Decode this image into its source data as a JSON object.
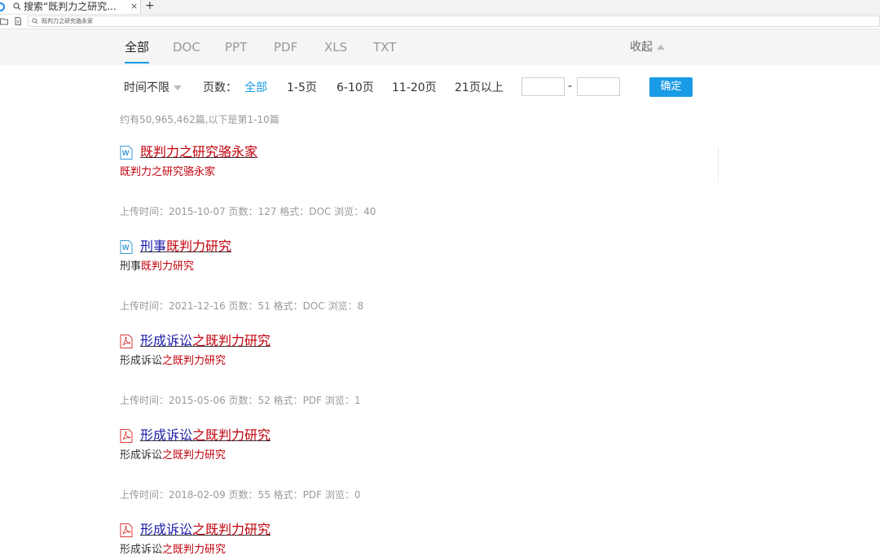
{
  "browser": {
    "tab_title": "搜索“既判力之研究...",
    "tab_close": "×",
    "new_tab": "+",
    "address_text": "既判力之研究骆永家"
  },
  "filters": {
    "type_tabs": [
      {
        "label": "全部",
        "active": true
      },
      {
        "label": "DOC",
        "active": false
      },
      {
        "label": "PPT",
        "active": false
      },
      {
        "label": "PDF",
        "active": false
      },
      {
        "label": "XLS",
        "active": false
      },
      {
        "label": "TXT",
        "active": false
      }
    ],
    "collapse_label": "收起",
    "time_label": "时间不限",
    "pages_label": "页数：",
    "page_options": [
      {
        "label": "全部",
        "active": true
      },
      {
        "label": "1-5页",
        "active": false
      },
      {
        "label": "6-10页",
        "active": false
      },
      {
        "label": "11-20页",
        "active": false
      },
      {
        "label": "21页以上",
        "active": false
      }
    ],
    "range_from": "",
    "range_to": "",
    "range_separator": "-",
    "confirm_label": "确定"
  },
  "result_count": "约有50,965,462篇,以下是第1-10篇",
  "colors": {
    "accent": "#1a9be6",
    "highlight": "#c0000b",
    "link": "#1a1aa6"
  },
  "results": [
    {
      "icon": "word-doc-icon",
      "title": [
        {
          "text": "既判力之研究骆永家",
          "hl": true
        }
      ],
      "snippet": [
        {
          "text": "既判力之研究骆永家",
          "hl": true
        }
      ],
      "meta": "上传时间：2015-10-07    页数：127    格式：DOC    浏览：40"
    },
    {
      "icon": "word-doc-icon",
      "title": [
        {
          "text": "刑事",
          "hl": false
        },
        {
          "text": "既判力研究",
          "hl": true
        }
      ],
      "snippet": [
        {
          "text": "刑事",
          "hl": false
        },
        {
          "text": "既判力研究",
          "hl": true
        }
      ],
      "meta": "上传时间：2021-12-16    页数：51    格式：DOC    浏览：8"
    },
    {
      "icon": "pdf-icon",
      "title": [
        {
          "text": "形成诉讼",
          "hl": false
        },
        {
          "text": "之既判力研究",
          "hl": true
        }
      ],
      "snippet": [
        {
          "text": "形成诉讼",
          "hl": false
        },
        {
          "text": "之既判力研究",
          "hl": true
        }
      ],
      "meta": "上传时间：2015-05-06    页数：52    格式：PDF    浏览：1"
    },
    {
      "icon": "pdf-icon",
      "title": [
        {
          "text": "形成诉讼",
          "hl": false
        },
        {
          "text": "之既判力研究",
          "hl": true
        }
      ],
      "snippet": [
        {
          "text": "形成诉讼",
          "hl": false
        },
        {
          "text": "之既判力研究",
          "hl": true
        }
      ],
      "meta": "上传时间：2018-02-09    页数：55    格式：PDF    浏览：0"
    },
    {
      "icon": "pdf-icon",
      "title": [
        {
          "text": "形成诉讼",
          "hl": false
        },
        {
          "text": "之既判力研究",
          "hl": true
        }
      ],
      "snippet": [
        {
          "text": "形成诉讼",
          "hl": false
        },
        {
          "text": "之既判力研究",
          "hl": true
        }
      ],
      "meta": ""
    }
  ]
}
